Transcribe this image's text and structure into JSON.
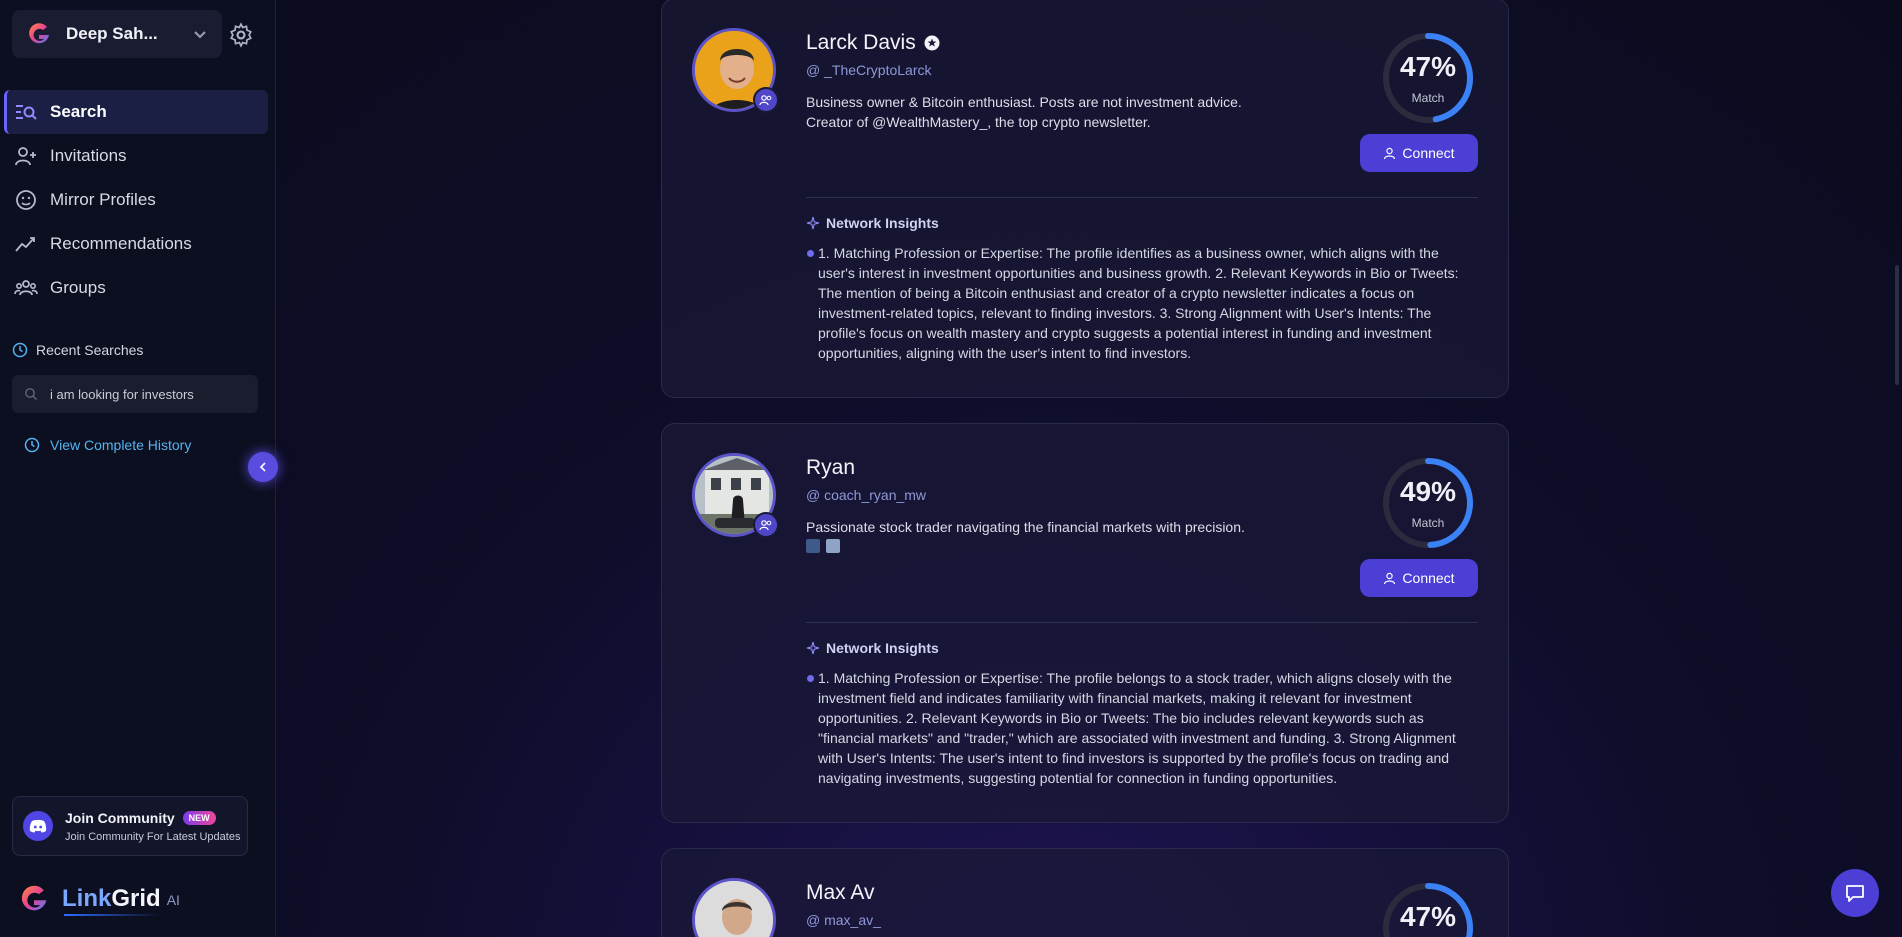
{
  "sidebar": {
    "user_name": "Deep Sah...",
    "nav": [
      {
        "label": "Search",
        "active": true,
        "icon": "search-list-icon"
      },
      {
        "label": "Invitations",
        "active": false,
        "icon": "user-plus-icon"
      },
      {
        "label": "Mirror Profiles",
        "active": false,
        "icon": "mirror-face-icon"
      },
      {
        "label": "Recommendations",
        "active": false,
        "icon": "trend-icon"
      },
      {
        "label": "Groups",
        "active": false,
        "icon": "users-icon"
      }
    ],
    "recent_title": "Recent Searches",
    "recent_items": [
      "i am looking for investors"
    ],
    "view_history": "View Complete History",
    "community": {
      "title": "Join Community",
      "badge": "NEW",
      "subtitle": "Join Community For Latest Updates"
    },
    "brand": {
      "link": "Link",
      "grid": "Grid",
      "ai": "AI"
    }
  },
  "colors": {
    "accent": "#4b3fd6",
    "link": "#56b3f0",
    "ring": "#3b82f6"
  },
  "profiles": [
    {
      "name": "Larck Davis",
      "verified": true,
      "handle": "@ _TheCryptoLarck",
      "bio_lines": [
        "Business owner & Bitcoin enthusiast. Posts are not investment advice.",
        "Creator of @WealthMastery_, the top crypto newsletter."
      ],
      "match": "47%",
      "match_value": 47,
      "match_label": "Match",
      "connect": "Connect",
      "insights_title": "Network Insights",
      "insights": "1. Matching Profession or Expertise: The profile identifies as a business owner, which aligns with the user's interest in investment opportunities and business growth. 2. Relevant Keywords in Bio or Tweets: The mention of being a Bitcoin enthusiast and creator of a crypto newsletter indicates a focus on investment-related topics, relevant to finding investors. 3. Strong Alignment with User's Intents: The profile's focus on wealth mastery and crypto suggests a potential interest in funding and investment opportunities, aligning with the user's intent to find investors."
    },
    {
      "name": "Ryan",
      "verified": false,
      "handle": "@ coach_ryan_mw",
      "bio_lines": [
        "Passionate stock trader navigating the financial markets with precision."
      ],
      "match": "49%",
      "match_value": 49,
      "match_label": "Match",
      "connect": "Connect",
      "insights_title": "Network Insights",
      "insights": "1. Matching Profession or Expertise: The profile belongs to a stock trader, which aligns closely with the investment field and indicates familiarity with financial markets, making it relevant for investment opportunities. 2. Relevant Keywords in Bio or Tweets: The bio includes relevant keywords such as \"financial markets\" and \"trader,\" which are associated with investment and funding. 3. Strong Alignment with User's Intents: The user's intent to find investors is supported by the profile's focus on trading and navigating investments, suggesting potential for connection in funding opportunities."
    },
    {
      "name": "Max Av",
      "verified": false,
      "handle": "@ max_av_",
      "match": "47%",
      "match_value": 47
    }
  ]
}
